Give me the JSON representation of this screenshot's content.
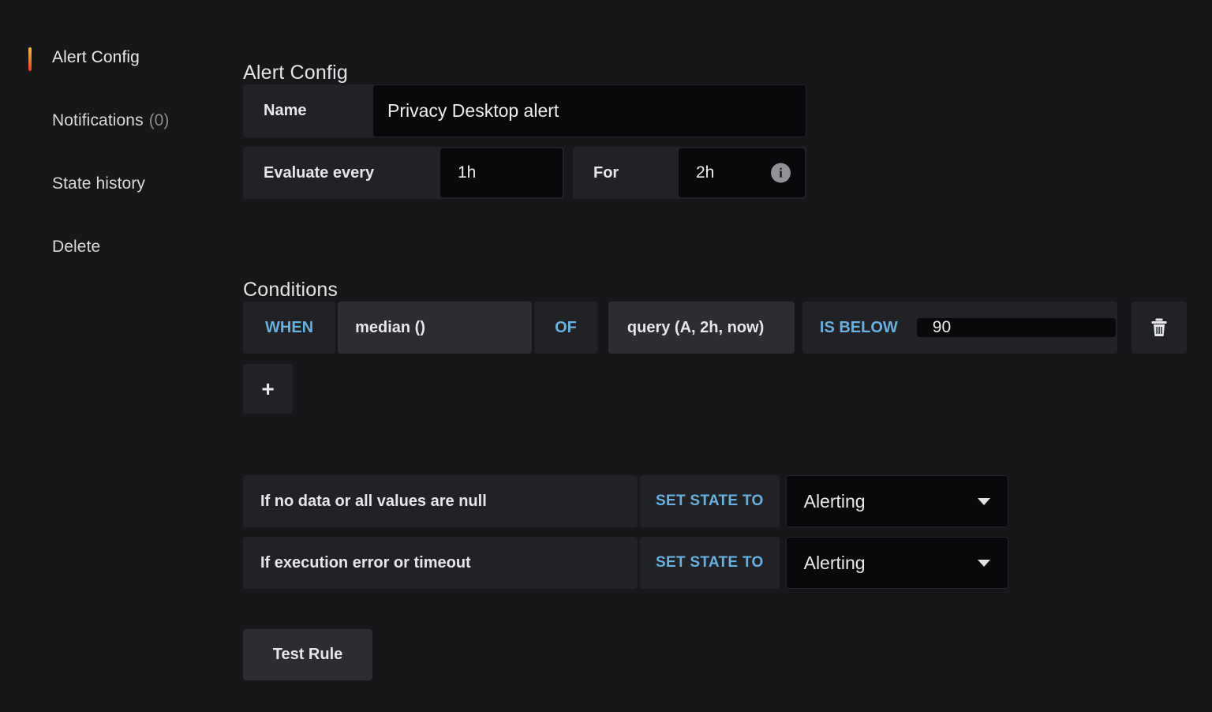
{
  "sidebar": {
    "items": [
      {
        "label": "Alert Config",
        "count": "",
        "active": true
      },
      {
        "label": "Notifications",
        "count": "(0)",
        "active": false
      },
      {
        "label": "State history",
        "count": "",
        "active": false
      },
      {
        "label": "Delete",
        "count": "",
        "active": false
      }
    ]
  },
  "main": {
    "alert_config_title": "Alert Config",
    "conditions_title": "Conditions",
    "name_field": {
      "label": "Name",
      "value": "Privacy Desktop alert"
    },
    "evaluate": {
      "every_label": "Evaluate every",
      "every_value": "1h",
      "for_label": "For",
      "for_value": "2h",
      "info_glyph": "i"
    },
    "condition": {
      "when": "WHEN",
      "reducer": "median ()",
      "of": "OF",
      "query": "query (A, 2h, now)",
      "operator": "IS BELOW",
      "threshold": "90",
      "delete_title": "Delete condition"
    },
    "add_condition_label": "+",
    "state_handling": [
      {
        "description": "If no data or all values are null",
        "set_state_label": "SET STATE TO",
        "state_value": "Alerting"
      },
      {
        "description": "If execution error or timeout",
        "set_state_label": "SET STATE TO",
        "state_value": "Alerting"
      }
    ],
    "test_rule_label": "Test Rule"
  },
  "colors": {
    "page_background": "#161719",
    "panel_background": "#202226",
    "input_background": "#09090b",
    "accent_blue": "#6ab0de",
    "active_indicator_start": "#f5b73d",
    "active_indicator_end": "#e0451f",
    "text_primary": "#e6e7e8",
    "text_muted": "#8e8e8e"
  }
}
